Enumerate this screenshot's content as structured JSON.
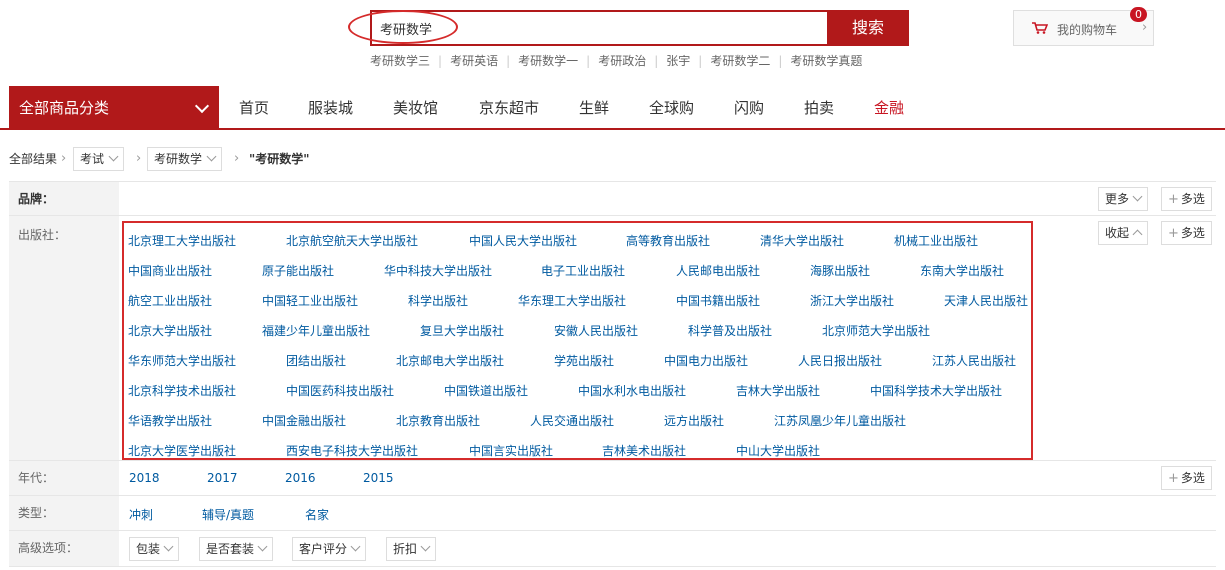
{
  "search": {
    "query": "考研数学",
    "button_label": "搜索",
    "hotwords": [
      "考研数学三",
      "考研英语",
      "考研数学一",
      "考研政治",
      "张宇",
      "考研数学二",
      "考研数学真题"
    ]
  },
  "cart": {
    "label": "我的购物车",
    "count": "0",
    "icon": "cart-icon"
  },
  "nav": {
    "category_label": "全部商品分类",
    "items": [
      "首页",
      "服装城",
      "美妆馆",
      "京东超市",
      "生鲜",
      "全球购",
      "闪购",
      "拍卖",
      "金融"
    ],
    "highlight_color": "#c81623"
  },
  "breadcrumb": {
    "root": "全部结果",
    "level1": "考试",
    "level2": "考研数学",
    "current": "\"考研数学\""
  },
  "filters": {
    "brand": {
      "label": "品牌：",
      "more": "更多",
      "multi": "多选"
    },
    "publisher": {
      "label": "出版社：",
      "collapse": "收起",
      "multi": "多选",
      "items": [
        "北京理工大学出版社",
        "北京航空航天大学出版社",
        "中国人民大学出版社",
        "高等教育出版社",
        "清华大学出版社",
        "机械工业出版社",
        "中国商业出版社",
        "原子能出版社",
        "华中科技大学出版社",
        "电子工业出版社",
        "人民邮电出版社",
        "海豚出版社",
        "东南大学出版社",
        "航空工业出版社",
        "中国轻工业出版社",
        "科学出版社",
        "华东理工大学出版社",
        "中国书籍出版社",
        "浙江大学出版社",
        "天津人民出版社",
        "北京大学出版社",
        "福建少年儿童出版社",
        "复旦大学出版社",
        "安徽人民出版社",
        "科学普及出版社",
        "北京师范大学出版社",
        "华东师范大学出版社",
        "团结出版社",
        "北京邮电大学出版社",
        "学苑出版社",
        "中国电力出版社",
        "人民日报出版社",
        "江苏人民出版社",
        "北京科学技术出版社",
        "中国医药科技出版社",
        "中国铁道出版社",
        "中国水利水电出版社",
        "吉林大学出版社",
        "中国科学技术大学出版社",
        "华语教学出版社",
        "中国金融出版社",
        "北京教育出版社",
        "人民交通出版社",
        "远方出版社",
        "江苏凤凰少年儿童出版社",
        "北京大学医学出版社",
        "西安电子科技大学出版社",
        "中国言实出版社",
        "吉林美术出版社",
        "中山大学出版社"
      ]
    },
    "year": {
      "label": "年代：",
      "multi": "多选",
      "items": [
        "2018",
        "2017",
        "2016",
        "2015"
      ]
    },
    "type": {
      "label": "类型：",
      "items": [
        "冲刺",
        "辅导/真题",
        "名家"
      ]
    },
    "advanced": {
      "label": "高级选项：",
      "items": [
        "包装",
        "是否套装",
        "客户评分",
        "折扣"
      ]
    }
  },
  "colors": {
    "brand_red": "#b1191a",
    "link_blue": "#005aa0",
    "highlight_outline": "#d52b2b"
  }
}
